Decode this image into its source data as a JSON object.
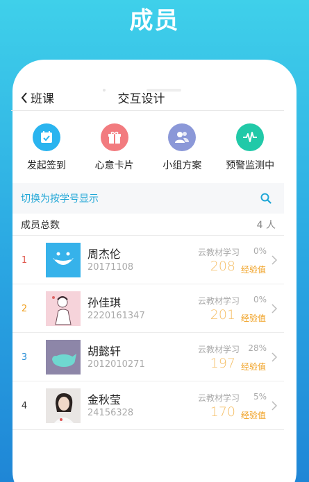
{
  "banner": {
    "title": "成员"
  },
  "nav": {
    "back_label": "班课",
    "title": "交互设计"
  },
  "features": [
    {
      "label": "发起签到",
      "icon": "calendar-check-icon",
      "color": "#2ab4ef"
    },
    {
      "label": "心意卡片",
      "icon": "gift-icon",
      "color": "#f27b7f"
    },
    {
      "label": "小组方案",
      "icon": "group-people-icon",
      "color": "#8b98d8"
    },
    {
      "label": "预警监测中",
      "icon": "pulse-monitor-icon",
      "color": "#21c9a8"
    }
  ],
  "switcher": {
    "label": "切换为按学号显示"
  },
  "summary": {
    "label": "成员总数",
    "count": "4 人"
  },
  "members": [
    {
      "rank": "1",
      "rank_color": "#e05a4f",
      "name": "周杰伦",
      "student_id": "20171108",
      "course": "云教材学习",
      "percent": "0%",
      "score": "208",
      "unit": "经验值"
    },
    {
      "rank": "2",
      "rank_color": "#f0a020",
      "name": "孙佳琪",
      "student_id": "2220161347",
      "course": "云教材学习",
      "percent": "0%",
      "score": "201",
      "unit": "经验值"
    },
    {
      "rank": "3",
      "rank_color": "#2a8fd6",
      "name": "胡懿轩",
      "student_id": "2012010271",
      "course": "云教材学习",
      "percent": "28%",
      "score": "197",
      "unit": "经验值"
    },
    {
      "rank": "4",
      "rank_color": "#333333",
      "name": "金秋莹",
      "student_id": "24156328",
      "course": "云教材学习",
      "percent": "5%",
      "score": "170",
      "unit": "经验值"
    }
  ]
}
